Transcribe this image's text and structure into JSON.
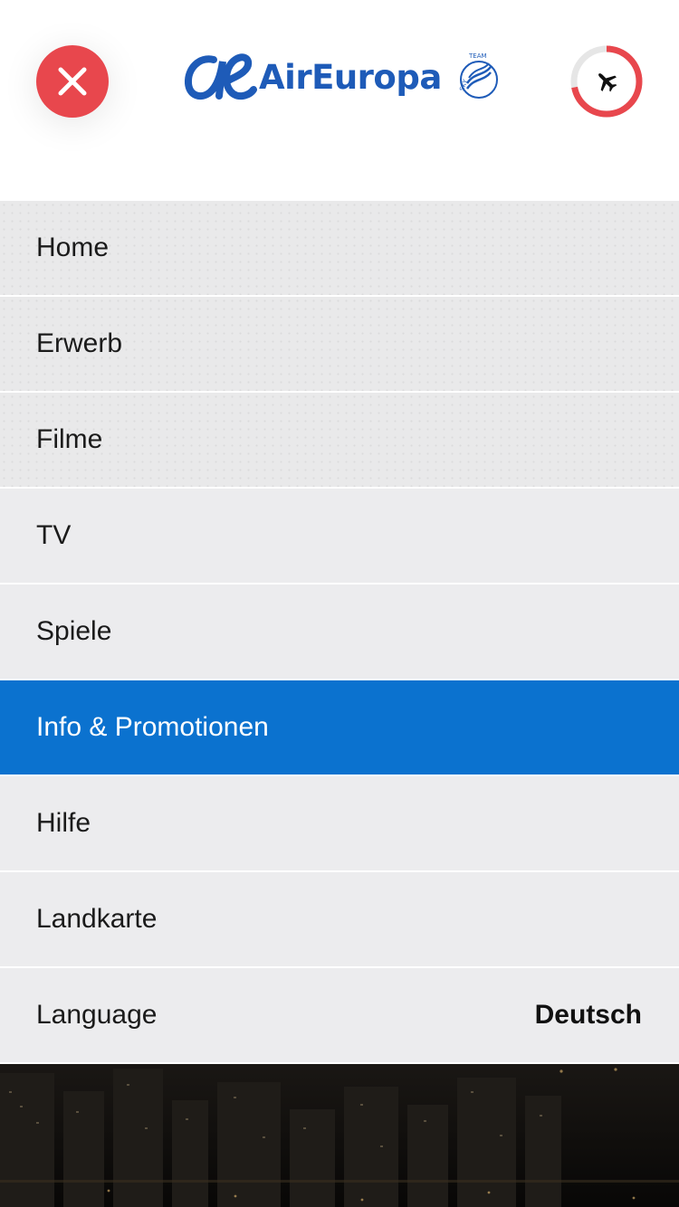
{
  "header": {
    "close_icon": "close-icon",
    "logo": {
      "brand_text": "AirEuropa",
      "alliance_text": "SKYTEAM",
      "brand_color": "#1e5bb8"
    },
    "flight_progress": {
      "icon": "airplane-icon",
      "progress_fraction": 0.72,
      "accent_color": "#e8474d"
    }
  },
  "menu": {
    "items": [
      {
        "label": "Home",
        "name": "menu-item-home"
      },
      {
        "label": "Erwerb",
        "name": "menu-item-erwerb"
      },
      {
        "label": "Filme",
        "name": "menu-item-filme"
      },
      {
        "label": "TV",
        "name": "menu-item-tv"
      },
      {
        "label": "Spiele",
        "name": "menu-item-spiele"
      },
      {
        "label": "Info & Promotionen",
        "name": "menu-item-info-promotionen",
        "active": true
      },
      {
        "label": "Hilfe",
        "name": "menu-item-hilfe"
      },
      {
        "label": "Landkarte",
        "name": "menu-item-landkarte"
      },
      {
        "label": "Language",
        "name": "menu-item-language",
        "value": "Deutsch"
      }
    ],
    "active_color": "#0b72cf"
  }
}
